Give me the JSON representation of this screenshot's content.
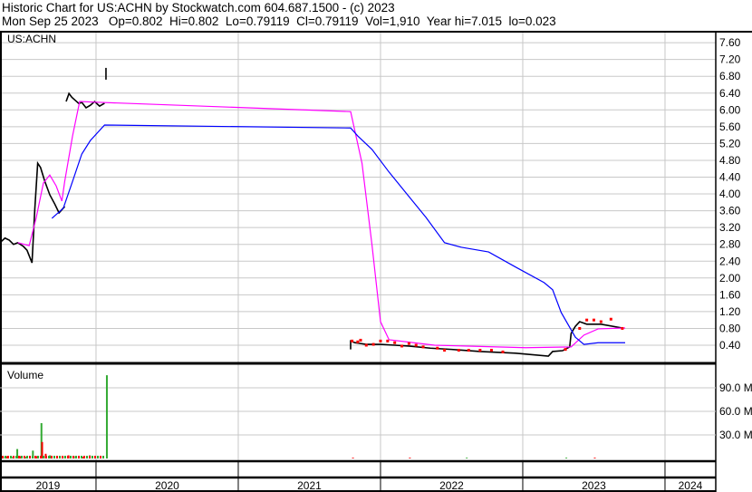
{
  "header": {
    "title": "Historic Chart for US:ACHN by Stockwatch.com 604.687.1500 - (c) 2023",
    "quote": "Mon Sep 25 2023   Op=0.802  Hi=0.802  Lo=0.79119  Cl=0.79119  Vol=1,910  Year hi=7.015  lo=0.023"
  },
  "colors": {
    "price": "#000000",
    "ma_short": "#ff00ff",
    "ma_long": "#0000ff",
    "down": "#ff0000",
    "up": "#33aa33",
    "grid": "#c8c8c8"
  },
  "chart_data": [
    {
      "type": "line",
      "title": "US:ACHN",
      "x_unit": "year",
      "ylim": [
        0,
        7.8
      ],
      "yticks": [
        "0.40",
        "0.80",
        "1.20",
        "1.60",
        "2.00",
        "2.40",
        "2.80",
        "3.20",
        "3.60",
        "4.00",
        "4.40",
        "4.80",
        "5.20",
        "5.60",
        "6.00",
        "6.40",
        "6.80",
        "7.20",
        "7.60"
      ],
      "grid": true,
      "series": [
        {
          "name": "Price",
          "segments": [
            [
              [
                2019.325,
                2.84
              ],
              [
                2019.36,
                2.95
              ],
              [
                2019.39,
                2.9
              ],
              [
                2019.42,
                2.8
              ],
              [
                2019.45,
                2.84
              ],
              [
                2019.49,
                2.75
              ],
              [
                2019.515,
                2.66
              ],
              [
                2019.55,
                2.36
              ],
              [
                2019.57,
                3.66
              ],
              [
                2019.59,
                4.73
              ],
              [
                2019.61,
                4.63
              ],
              [
                2019.64,
                4.3
              ],
              [
                2019.675,
                3.98
              ],
              [
                2019.71,
                3.76
              ],
              [
                2019.74,
                3.55
              ],
              [
                2019.78,
                3.7
              ]
            ],
            [
              [
                2019.79,
                6.2
              ],
              [
                2019.81,
                6.39
              ],
              [
                2019.83,
                6.3
              ],
              [
                2019.85,
                6.24
              ],
              [
                2019.88,
                6.15
              ],
              [
                2019.9,
                6.18
              ],
              [
                2019.93,
                6.05
              ],
              [
                2019.96,
                6.11
              ],
              [
                2019.99,
                6.2
              ],
              [
                2020.025,
                6.09
              ],
              [
                2020.06,
                6.16
              ]
            ],
            [
              [
                2020.07,
                6.72
              ],
              [
                2020.07,
                7.0
              ]
            ],
            [
              [
                2021.79,
                0.3
              ],
              [
                2021.79,
                0.5
              ],
              [
                2021.82,
                0.46
              ],
              [
                2021.86,
                0.44
              ],
              [
                2021.9,
                0.42
              ],
              [
                2022.0,
                0.42
              ],
              [
                2022.1,
                0.4
              ],
              [
                2022.2,
                0.38
              ],
              [
                2022.35,
                0.33
              ],
              [
                2022.5,
                0.3
              ],
              [
                2022.7,
                0.25
              ],
              [
                2022.95,
                0.21
              ],
              [
                2023.18,
                0.14
              ],
              [
                2023.21,
                0.25
              ],
              [
                2023.28,
                0.27
              ],
              [
                2023.33,
                0.36
              ],
              [
                2023.34,
                0.68
              ],
              [
                2023.37,
                0.85
              ],
              [
                2023.4,
                0.96
              ],
              [
                2023.45,
                0.9
              ],
              [
                2023.55,
                0.9
              ],
              [
                2023.7,
                0.81
              ]
            ]
          ]
        },
        {
          "name": "MA short",
          "points": [
            [
              2019.45,
              2.84
            ],
            [
              2019.53,
              2.77
            ],
            [
              2019.58,
              3.44
            ],
            [
              2019.63,
              4.26
            ],
            [
              2019.675,
              4.45
            ],
            [
              2019.72,
              4.19
            ],
            [
              2019.76,
              3.83
            ],
            [
              2019.78,
              4.3
            ],
            [
              2019.835,
              5.38
            ],
            [
              2019.885,
              6.2
            ],
            [
              2020.025,
              6.18
            ],
            [
              2021.79,
              5.96
            ],
            [
              2021.87,
              4.73
            ],
            [
              2021.94,
              2.79
            ],
            [
              2022.0,
              0.96
            ],
            [
              2022.06,
              0.53
            ],
            [
              2022.38,
              0.4
            ],
            [
              2023.02,
              0.34
            ],
            [
              2023.34,
              0.36
            ],
            [
              2023.43,
              0.64
            ],
            [
              2023.53,
              0.79
            ],
            [
              2023.72,
              0.81
            ]
          ]
        },
        {
          "name": "MA long",
          "points": [
            [
              2019.69,
              3.42
            ],
            [
              2019.77,
              3.66
            ],
            [
              2019.835,
              4.3
            ],
            [
              2019.9,
              4.95
            ],
            [
              2019.96,
              5.27
            ],
            [
              2020.06,
              5.64
            ],
            [
              2021.79,
              5.57
            ],
            [
              2021.84,
              5.38
            ],
            [
              2021.94,
              5.06
            ],
            [
              2022.06,
              4.52
            ],
            [
              2022.19,
              3.98
            ],
            [
              2022.32,
              3.44
            ],
            [
              2022.45,
              2.84
            ],
            [
              2022.57,
              2.73
            ],
            [
              2022.76,
              2.62
            ],
            [
              2022.955,
              2.25
            ],
            [
              2023.15,
              1.89
            ],
            [
              2023.21,
              1.72
            ],
            [
              2023.27,
              1.18
            ],
            [
              2023.37,
              0.59
            ],
            [
              2023.43,
              0.42
            ],
            [
              2023.53,
              0.46
            ],
            [
              2023.72,
              0.46
            ]
          ]
        }
      ],
      "down_closes": [
        [
          2021.8,
          0.5
        ],
        [
          2021.84,
          0.48
        ],
        [
          2021.86,
          0.52
        ],
        [
          2021.9,
          0.4
        ],
        [
          2021.95,
          0.42
        ],
        [
          2022.0,
          0.5
        ],
        [
          2022.05,
          0.5
        ],
        [
          2022.1,
          0.46
        ],
        [
          2022.15,
          0.38
        ],
        [
          2022.2,
          0.44
        ],
        [
          2022.25,
          0.4
        ],
        [
          2022.3,
          0.36
        ],
        [
          2022.4,
          0.33
        ],
        [
          2022.45,
          0.28
        ],
        [
          2022.55,
          0.28
        ],
        [
          2022.62,
          0.28
        ],
        [
          2022.7,
          0.28
        ],
        [
          2022.78,
          0.28
        ],
        [
          2022.86,
          0.24
        ],
        [
          2023.3,
          0.3
        ],
        [
          2023.4,
          0.8
        ],
        [
          2023.45,
          1.0
        ],
        [
          2023.5,
          1.0
        ],
        [
          2023.55,
          0.96
        ],
        [
          2023.62,
          1.02
        ],
        [
          2023.7,
          0.8
        ]
      ]
    },
    {
      "type": "bar",
      "title": "Volume",
      "x_unit": "year",
      "ylim": [
        0,
        110
      ],
      "yticks": [
        "30.0 M",
        "60.0 M",
        "90.0 M"
      ],
      "bars": [
        [
          2019.34,
          2,
          "up"
        ],
        [
          2019.37,
          3,
          "down"
        ],
        [
          2019.4,
          2,
          "up"
        ],
        [
          2019.44,
          12,
          "up"
        ],
        [
          2019.46,
          3,
          "down"
        ],
        [
          2019.5,
          2,
          "up"
        ],
        [
          2019.55,
          10,
          "up"
        ],
        [
          2019.58,
          3,
          "down"
        ],
        [
          2019.61,
          45,
          "up"
        ],
        [
          2019.615,
          21,
          "down"
        ],
        [
          2019.64,
          6,
          "down"
        ],
        [
          2019.67,
          4,
          "up"
        ],
        [
          2019.72,
          3,
          "down"
        ],
        [
          2019.76,
          3,
          "up"
        ],
        [
          2019.8,
          4,
          "down"
        ],
        [
          2019.85,
          3,
          "up"
        ],
        [
          2019.9,
          2,
          "down"
        ],
        [
          2019.95,
          4,
          "up"
        ],
        [
          2020.07,
          106,
          "up"
        ],
        [
          2021.8,
          1,
          "down"
        ],
        [
          2022.2,
          1,
          "down"
        ],
        [
          2022.6,
          1,
          "up"
        ],
        [
          2023.3,
          1,
          "up"
        ],
        [
          2023.5,
          1,
          "down"
        ]
      ]
    }
  ],
  "years": [
    "2019",
    "2020",
    "2021",
    "2022",
    "2023",
    "2024"
  ]
}
